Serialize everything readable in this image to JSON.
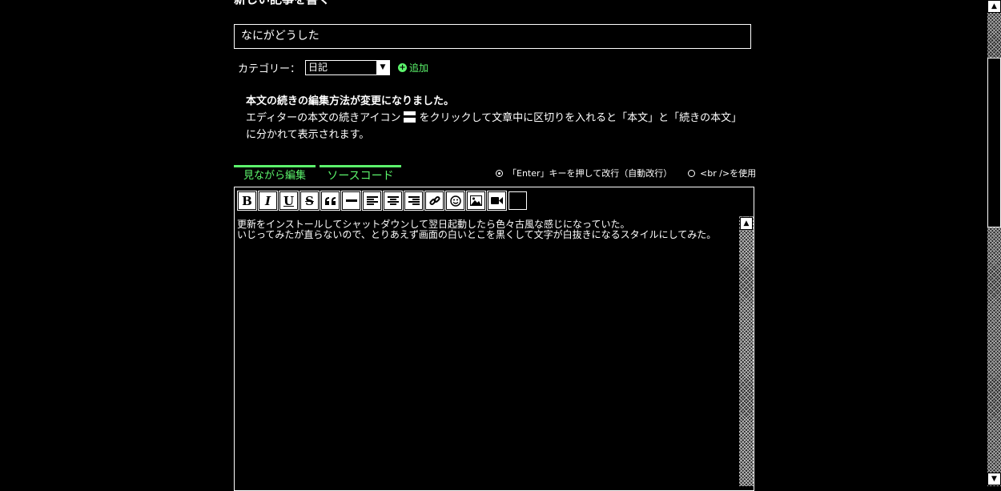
{
  "page": {
    "heading": "新しい記事を書く",
    "title_value": "なにがどうした"
  },
  "category": {
    "label": "カテゴリー：",
    "selected": "日記",
    "add_label": "追加"
  },
  "notice": {
    "title": "本文の続きの編集方法が変更になりました。",
    "line1_a": "エディターの本文の続きアイコン",
    "line1_b": "をクリックして文章中に区切りを入れると「本文」と「続きの本文」",
    "line2": "に分かれて表示されます。"
  },
  "tabs": [
    {
      "label": "見ながら編集"
    },
    {
      "label": "ソースコード"
    }
  ],
  "linebreak": {
    "option_enter": "「Enter」キーを押して改行（自動改行）",
    "option_br": "<br />を使用",
    "selected": "enter"
  },
  "toolbar": {
    "bold": "B",
    "italic": "I",
    "underline": "U",
    "strike": "S",
    "icons": [
      "bold-icon",
      "italic-icon",
      "underline-icon",
      "strikethrough-icon",
      "quote-icon",
      "horizontal-rule-icon",
      "align-left-icon",
      "align-center-icon",
      "align-right-icon",
      "link-icon",
      "emoji-icon",
      "image-icon",
      "video-icon"
    ]
  },
  "content": {
    "line1": "更新をインストールしてシャットダウンして翌日起動したら色々古風な感じになっていた。",
    "line2": "いじってみたが直らないので、とりあえず画面の白いとこを黒くして文字が白抜きになるスタイルにしてみた。"
  },
  "colors": {
    "accent": "#5cf56c",
    "background": "#000000",
    "foreground": "#ffffff"
  }
}
